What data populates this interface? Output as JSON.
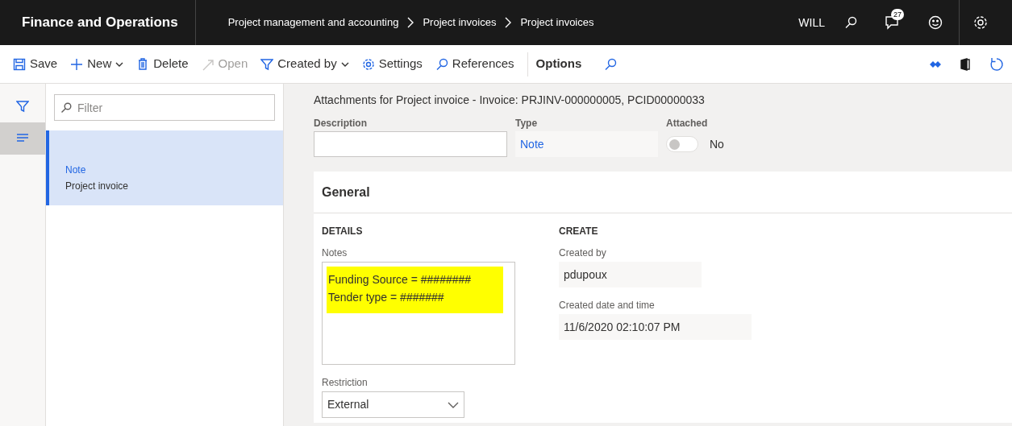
{
  "header": {
    "app_title": "Finance and Operations",
    "breadcrumbs": [
      "Project management and accounting",
      "Project invoices",
      "Project invoices"
    ],
    "user": "WILL",
    "notification_count": "27"
  },
  "toolbar": {
    "actions": [
      {
        "kind": "save",
        "label": "Save",
        "disabled": false,
        "dropdown": false
      },
      {
        "kind": "new",
        "label": "New",
        "disabled": false,
        "dropdown": true
      },
      {
        "kind": "delete",
        "label": "Delete",
        "disabled": false,
        "dropdown": false
      },
      {
        "kind": "open",
        "label": "Open",
        "disabled": true,
        "dropdown": false
      },
      {
        "kind": "filter",
        "label": "Created by",
        "disabled": false,
        "dropdown": true
      },
      {
        "kind": "settings",
        "label": "Settings",
        "disabled": false,
        "dropdown": false
      },
      {
        "kind": "references",
        "label": "References",
        "disabled": false,
        "dropdown": false
      }
    ],
    "options_tab": "Options"
  },
  "rail": [
    {
      "kind": "filter",
      "selected": false
    },
    {
      "kind": "list",
      "selected": true
    }
  ],
  "list": {
    "filter_placeholder": "Filter",
    "items": [
      {
        "type": "Note",
        "name": "Project invoice",
        "selected": true
      }
    ]
  },
  "form": {
    "title": "Attachments for Project invoice - Invoice: PRJINV-000000005, PCID00000033",
    "description": {
      "label": "Description"
    },
    "type": {
      "label": "Type",
      "value": "Note"
    },
    "attached": {
      "label": "Attached",
      "on": false,
      "value_label": "No"
    },
    "general": {
      "title": "General",
      "details": {
        "heading": "DETAILS",
        "notes_label": "Notes",
        "notes": [
          "Funding Source = ########",
          "Tender type = #######"
        ],
        "highlighted": true,
        "restriction_label": "Restriction",
        "restriction": "External"
      },
      "create": {
        "heading": "CREATE",
        "fields": [
          {
            "label": "Created by",
            "value": "pdupoux"
          },
          {
            "label": "Created date and time",
            "value": "11/6/2020 02:10:07 PM"
          }
        ]
      }
    }
  }
}
